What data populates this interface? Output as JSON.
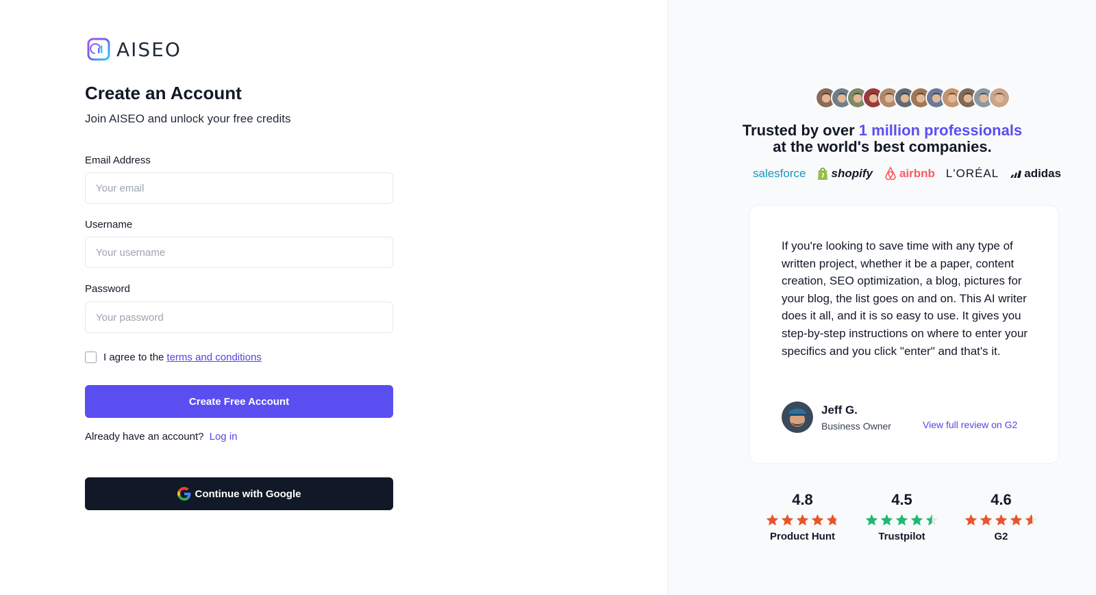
{
  "brand": {
    "name": "AISEO",
    "logo_icon": "aiseo-logo-icon"
  },
  "form": {
    "title": "Create an Account",
    "subtitle": "Join AISEO and unlock your free credits",
    "email": {
      "label": "Email Address",
      "placeholder": "Your email",
      "value": ""
    },
    "username": {
      "label": "Username",
      "placeholder": "Your username",
      "value": ""
    },
    "password": {
      "label": "Password",
      "placeholder": "Your password",
      "value": ""
    },
    "agree": {
      "text": "I agree to the",
      "link": "terms and conditions",
      "checked": false
    },
    "submit_label": "Create Free Account",
    "login_prompt": "Already have an account?",
    "login_link": "Log in",
    "google_label": "Continue with Google",
    "google_icon": "google-g-icon"
  },
  "colors": {
    "primary": "#5b4ef0",
    "dark": "#111827",
    "link": "#4f46e5",
    "panel_bg": "#f9fafb"
  },
  "social_proof": {
    "avatar_count": 12,
    "headline_prefix": "Trusted by over",
    "headline_accent": "1 million professionals",
    "headline_line2": "at the world's best companies.",
    "brands": [
      "salesforce",
      "shopify",
      "airbnb",
      "L'ORÉAL",
      "adidas"
    ]
  },
  "review": {
    "text": "If you're looking to save time with any type of written project, whether it be a paper, content creation, SEO optimization, a blog, pictures for your blog, the list goes on and on. This AI writer does it all, and it is so easy to use. It gives you step-by-step instructions on where to enter your specifics and you click \"enter\" and that's it.",
    "author": "Jeff G.",
    "role": "Business Owner",
    "link": "View full review on G2"
  },
  "ratings": [
    {
      "score": "4.8",
      "source": "Product Hunt",
      "stars": 4.8,
      "color": "#e8552b"
    },
    {
      "score": "4.5",
      "source": "Trustpilot",
      "stars": 4.5,
      "color": "#1db973"
    },
    {
      "score": "4.6",
      "source": "G2",
      "stars": 4.6,
      "color": "#e8552b"
    }
  ]
}
